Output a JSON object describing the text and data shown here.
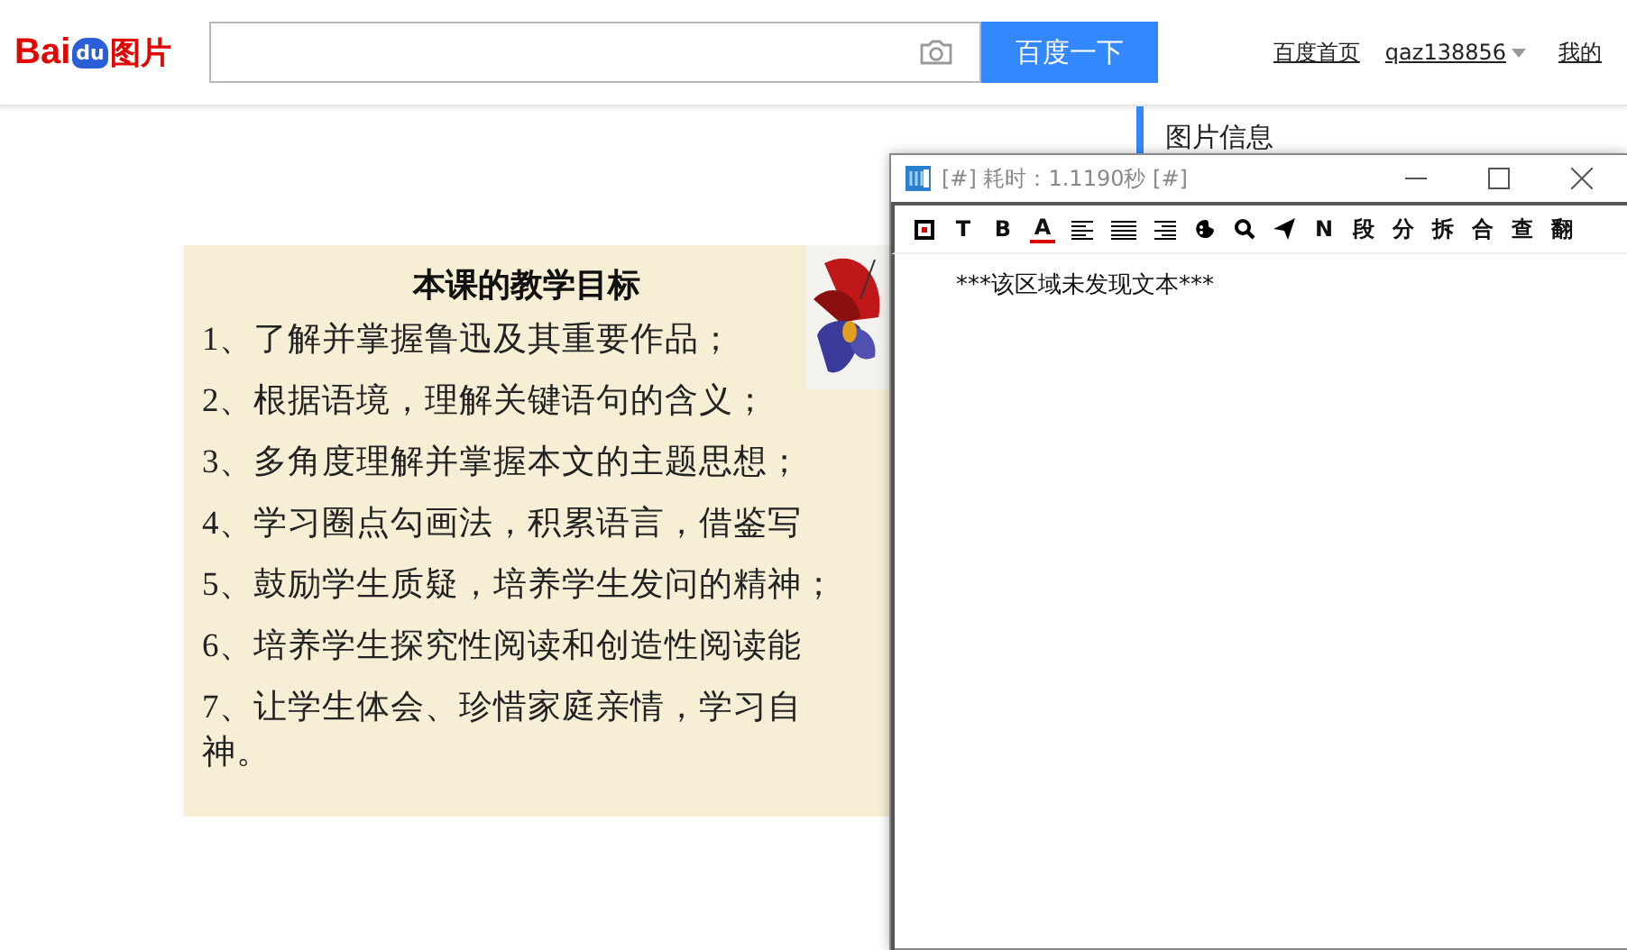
{
  "header": {
    "logo_latin": "Bai",
    "logo_paw": "du",
    "logo_cn": "图片",
    "search_button": "百度一下",
    "links": [
      {
        "kind": "link",
        "label": "百度首页"
      },
      {
        "kind": "menu",
        "label": "qaz138856"
      },
      {
        "kind": "link",
        "label": "我的"
      }
    ]
  },
  "side_panel": {
    "title": "图片信息"
  },
  "slide": {
    "title": "本课的教学目标",
    "lines": [
      "1、了解并掌握鲁迅及其重要作品；",
      "2、根据语境，理解关键语句的含义；",
      "3、多角度理解并掌握本文的主题思想；",
      "4、学习圈点勾画法，积累语言，借鉴写",
      "5、鼓励学生质疑，培养学生发问的精神；",
      "6、培养学生探究性阅读和创造性阅读能",
      "7、让学生体会、珍惜家庭亲情，学习自",
      "神。"
    ]
  },
  "popup": {
    "title": "[#] 耗时：1.1190秒 [#]",
    "toolbar": [
      {
        "kind": "stop"
      },
      {
        "kind": "text",
        "label": "T"
      },
      {
        "kind": "text",
        "label": "B"
      },
      {
        "kind": "font-color",
        "label": "A"
      },
      {
        "kind": "align-left"
      },
      {
        "kind": "justify"
      },
      {
        "kind": "align-right"
      },
      {
        "kind": "palette"
      },
      {
        "kind": "search"
      },
      {
        "kind": "send"
      },
      {
        "kind": "text",
        "label": "N"
      },
      {
        "kind": "text",
        "label": "段"
      },
      {
        "kind": "text",
        "label": "分"
      },
      {
        "kind": "text",
        "label": "拆"
      },
      {
        "kind": "text",
        "label": "合"
      },
      {
        "kind": "text",
        "label": "查"
      },
      {
        "kind": "text",
        "label": "翻"
      }
    ],
    "body": "***该区域未发现文本***"
  }
}
